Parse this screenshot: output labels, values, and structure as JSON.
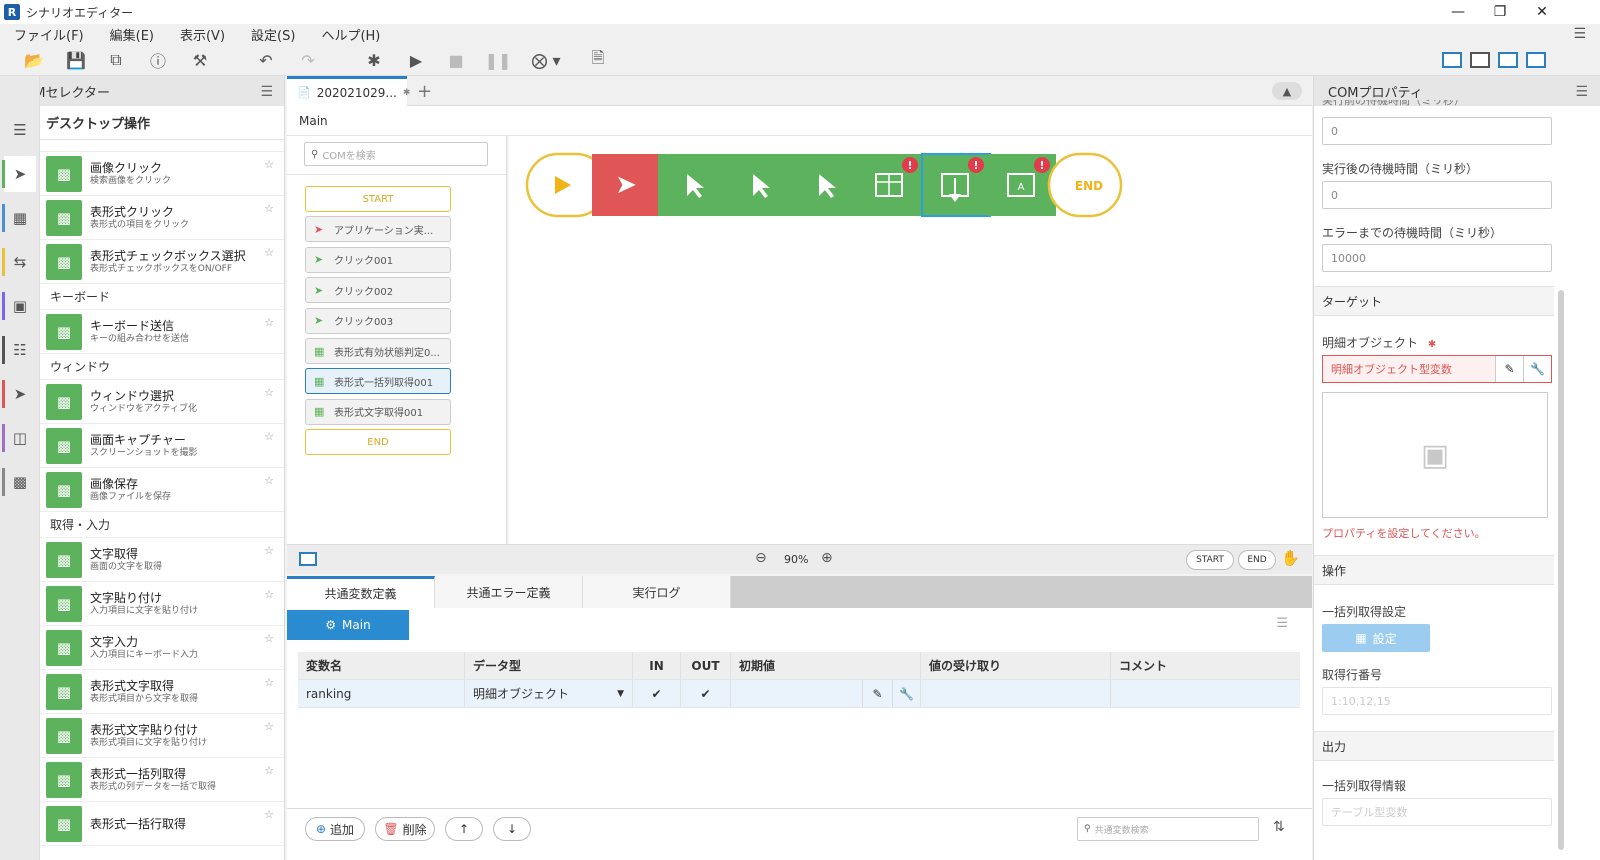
{
  "app": {
    "title": "シナリオエディター",
    "icon_letter": "R"
  },
  "menu": [
    "ファイル(F)",
    "編集(E)",
    "表示(V)",
    "設定(S)",
    "ヘルプ(H)"
  ],
  "selector": {
    "title": "COMセレクター",
    "section_title": "デスクトップ操作",
    "items": [
      {
        "name": "画像クリック",
        "desc": "検索画像をクリック",
        "icon": "image-click-icon"
      },
      {
        "name": "表形式クリック",
        "desc": "表形式の項目をクリック",
        "icon": "table-click-icon"
      },
      {
        "name": "表形式チェックボックス選択",
        "desc": "表形式チェックボックスをON/OFF",
        "icon": "table-checkbox-icon"
      }
    ],
    "cat_keyboard": "キーボード",
    "keyboard_items": [
      {
        "name": "キーボード送信",
        "desc": "キーの組み合わせを送信",
        "icon": "keyboard-icon"
      }
    ],
    "cat_window": "ウィンドウ",
    "window_items": [
      {
        "name": "ウィンドウ選択",
        "desc": "ウィンドウをアクティブ化",
        "icon": "window-icon"
      },
      {
        "name": "画面キャプチャー",
        "desc": "スクリーンショットを撮影",
        "icon": "camera-icon"
      },
      {
        "name": "画像保存",
        "desc": "画像ファイルを保存",
        "icon": "image-save-icon"
      }
    ],
    "cat_input": "取得・入力",
    "input_items": [
      {
        "name": "文字取得",
        "desc": "画面の文字を取得",
        "icon": "text-get-icon"
      },
      {
        "name": "文字貼り付け",
        "desc": "入力項目に文字を貼り付け",
        "icon": "text-paste-icon"
      },
      {
        "name": "文字入力",
        "desc": "入力項目にキーボード入力",
        "icon": "text-input-icon"
      },
      {
        "name": "表形式文字取得",
        "desc": "表形式項目から文字を取得",
        "icon": "table-text-get-icon"
      },
      {
        "name": "表形式文字貼り付け",
        "desc": "表形式項目に文字を貼り付け",
        "icon": "table-text-paste-icon"
      },
      {
        "name": "表形式一括列取得",
        "desc": "表形式の列データを一括で取得",
        "icon": "table-column-get-icon"
      },
      {
        "name": "表形式一括行取得",
        "desc": "",
        "icon": "table-row-get-icon"
      }
    ]
  },
  "editor": {
    "tab_label": "202021029...",
    "tab_modified": "✱",
    "breadcrumb": "Main",
    "search_placeholder": "COMを検索",
    "flow_items": [
      {
        "label": "START",
        "kind": "start"
      },
      {
        "label": "アプリケーション実...",
        "kind": "app"
      },
      {
        "label": "クリック001",
        "kind": "click"
      },
      {
        "label": "クリック002",
        "kind": "click"
      },
      {
        "label": "クリック003",
        "kind": "click"
      },
      {
        "label": "表形式有効状態判定0...",
        "kind": "table"
      },
      {
        "label": "表形式一括列取得001",
        "kind": "table",
        "selected": true
      },
      {
        "label": "表形式文字取得001",
        "kind": "table"
      },
      {
        "label": "END",
        "kind": "end"
      }
    ],
    "canvas_end_label": "END",
    "zoom": "90%",
    "start_btn": "START",
    "end_btn": "END"
  },
  "bottom": {
    "tabs": [
      "共通変数定義",
      "共通エラー定義",
      "実行ログ"
    ],
    "main_chip": "Main",
    "columns": [
      "変数名",
      "データ型",
      "IN",
      "OUT",
      "初期値",
      "値の受け取り",
      "コメント"
    ],
    "rows": [
      {
        "name": "ranking",
        "type": "明細オブジェクト",
        "in": "✔",
        "out": "✔",
        "init": "",
        "recv": "",
        "comment": ""
      }
    ],
    "add": "追加",
    "delete": "削除",
    "search_placeholder": "共通変数検索"
  },
  "props": {
    "title": "COMプロパティ",
    "cut_label": "実行前の待機時間（ミリ秒）",
    "before_wait": "0",
    "after_wait_label": "実行後の待機時間（ミリ秒）",
    "after_wait": "0",
    "error_wait_label": "エラーまでの待機時間（ミリ秒）",
    "error_wait": "10000",
    "target_section": "ターゲット",
    "detail_obj_label": "明細オブジェクト",
    "detail_obj_required": "✱",
    "detail_obj_placeholder": "明細オブジェクト型変数",
    "warning": "プロパティを設定してください。",
    "op_section": "操作",
    "bulk_setting_label": "一括列取得設定",
    "settings_btn": "設定",
    "row_number_label": "取得行番号",
    "row_number_placeholder": "1:10,12,15",
    "output_section": "出力",
    "bulk_info_label": "一括列取得情報",
    "bulk_info_placeholder": "テーブル型変数"
  }
}
